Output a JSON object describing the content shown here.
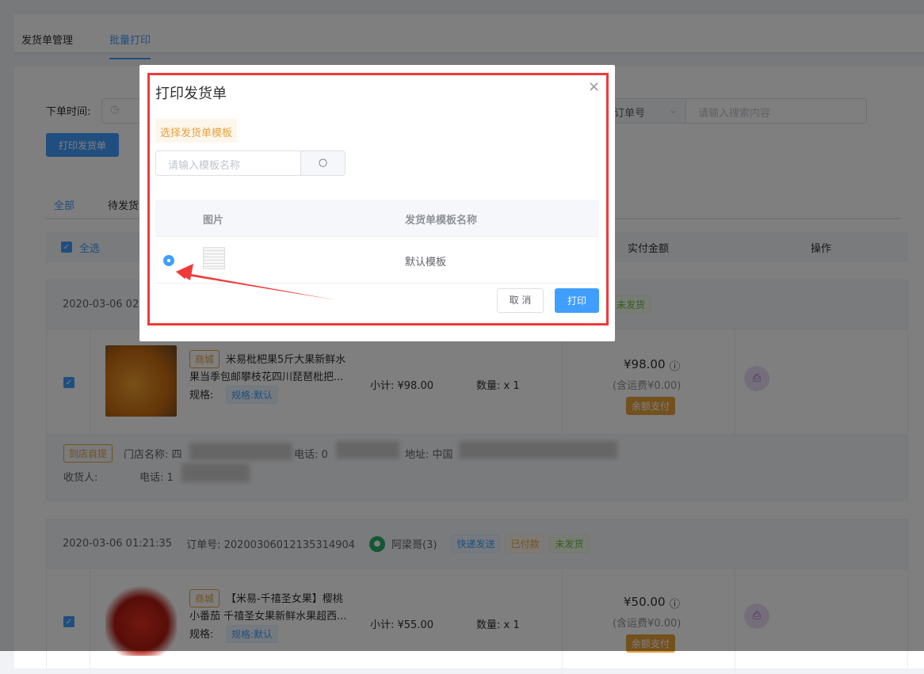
{
  "top_tabs": [
    "发货单管理",
    "批量打印"
  ],
  "filter": {
    "date_label": "下单时间:",
    "search_type": "订单号",
    "search_placeholder": "请输入搜索内容",
    "print_button": "打印发货单"
  },
  "status_tabs": [
    "全部",
    "待发货"
  ],
  "table_header": {
    "select_all": "全选",
    "amount": "实付金额",
    "action": "操作"
  },
  "orders": [
    {
      "time": "2020-03-06 02",
      "status": "未发货",
      "channel_tag": "商城",
      "title1": "米易枇杷果5斤大果新鲜水",
      "title2": "果当季包邮攀枝花四川琵琶枇把...",
      "spec_label": "规格:",
      "spec": "规格:默认",
      "subtotal": "小计: ¥98.00",
      "qty": "数量: x 1",
      "amount": "¥98.00",
      "shipping": "(含运费¥0.00)",
      "pay": "余额支付",
      "pickup_tag": "到店自提",
      "store": "门店名称: 四",
      "phone": "电话: 0",
      "address": "地址: 中国",
      "receiver": "收货人: ",
      "receiver_phone": "电话: 1"
    },
    {
      "time": "2020-03-06 01:21:35",
      "order_no": "订单号: 20200306012135314904",
      "buyer": "阿梁哥(3)",
      "tags": [
        "快递发送",
        "已付款",
        "未发货"
      ],
      "channel_tag": "商城",
      "title1": "【米易-千禧圣女果】樱桃",
      "title2": "小番茄 千禧圣女果新鲜水果超西...",
      "spec_label": "规格:",
      "spec": "规格:默认",
      "subtotal": "小计: ¥55.00",
      "qty": "数量: x 1",
      "amount": "¥50.00",
      "shipping": "(含运费¥0.00)",
      "pay": "余额支付"
    }
  ],
  "modal": {
    "title": "打印发货单",
    "section_label": "选择发货单模板",
    "search_placeholder": "请输入模板名称",
    "col_image": "图片",
    "col_name": "发货单模板名称",
    "rows": [
      {
        "name": "默认模板",
        "selected": true
      }
    ],
    "cancel": "取 消",
    "print": "打印"
  },
  "colors": {
    "primary": "#409eff",
    "annotation": "#f03a3a"
  }
}
